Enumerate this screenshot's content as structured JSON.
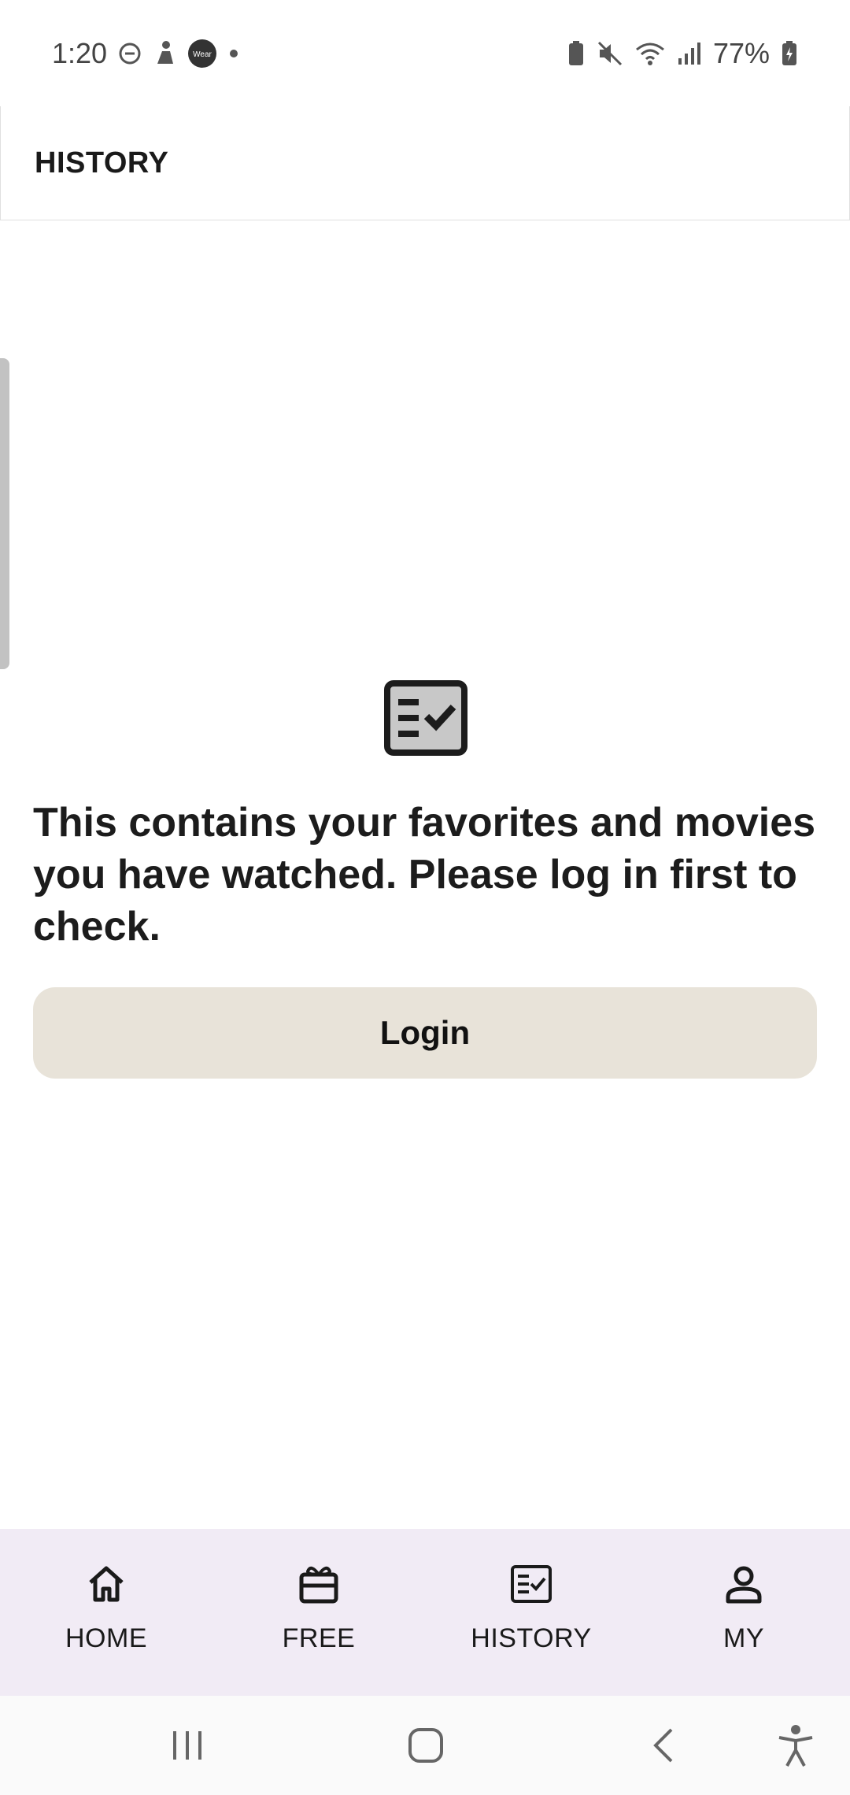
{
  "status_bar": {
    "time": "1:20",
    "battery": "77%",
    "icons_left": [
      "do-not-disturb-icon",
      "fitness-icon",
      "wear-icon",
      "dot-icon"
    ],
    "icons_right": [
      "battery-saver-icon",
      "mute-icon",
      "wifi-icon",
      "signal-icon",
      "battery-icon"
    ],
    "wear_text": "Wear"
  },
  "app_bar": {
    "title": "HISTORY"
  },
  "empty_state": {
    "icon": "checklist-icon",
    "message": "This contains your favorites and movies you have watched. Please log in first to check.",
    "login_label": "Login"
  },
  "bottom_nav": {
    "items": [
      {
        "label": "HOME",
        "icon": "home-icon"
      },
      {
        "label": "FREE",
        "icon": "gift-icon"
      },
      {
        "label": "HISTORY",
        "icon": "checklist-icon"
      },
      {
        "label": "MY",
        "icon": "person-icon"
      }
    ]
  },
  "system_nav": {
    "buttons": [
      "recent-apps-icon",
      "home-button-icon",
      "back-icon",
      "accessibility-icon"
    ]
  },
  "colors": {
    "login_button_bg": "#e8e3d9",
    "bottom_nav_bg": "#f1ebf5",
    "text": "#1a1a1a"
  }
}
